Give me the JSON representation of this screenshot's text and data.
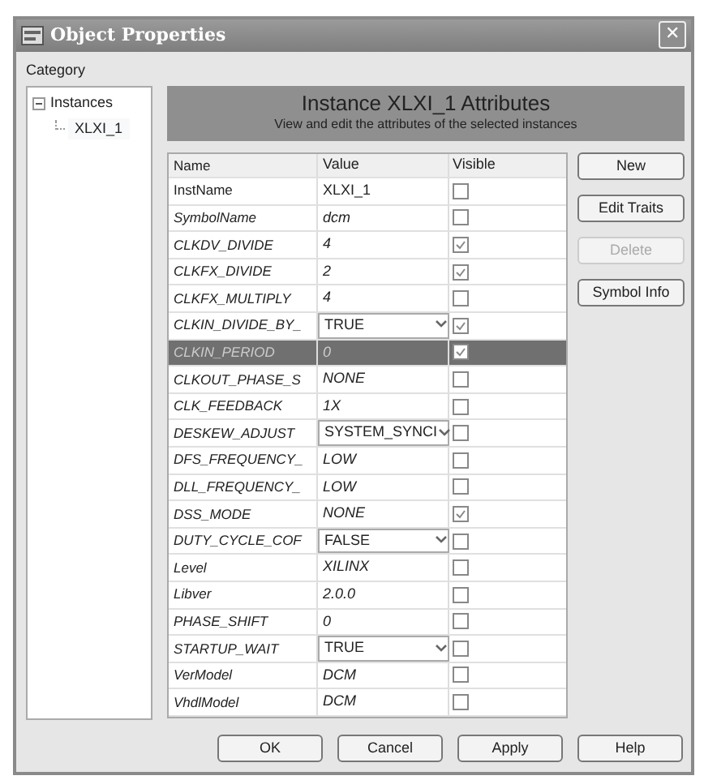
{
  "window": {
    "title": "Object Properties",
    "close": "✕"
  },
  "category": {
    "label": "Category",
    "tree": [
      {
        "label": "Instances",
        "expanded": true,
        "children": [
          {
            "label": "XLXI_1",
            "selected": true
          }
        ]
      }
    ]
  },
  "header": {
    "title": "Instance XLXI_1 Attributes",
    "subtitle": "View and edit the attributes of the selected instances"
  },
  "table": {
    "columns": [
      "Name",
      "Value",
      "Visible"
    ],
    "rows": [
      {
        "name": "InstName",
        "value": "XLXI_1",
        "kind": "fixed",
        "visible": false,
        "selected": false
      },
      {
        "name": "SymbolName",
        "value": "dcm",
        "kind": "text",
        "visible": false,
        "selected": false
      },
      {
        "name": "CLKDV_DIVIDE",
        "value": "4",
        "kind": "text",
        "visible": true,
        "selected": false
      },
      {
        "name": "CLKFX_DIVIDE",
        "value": "2",
        "kind": "text",
        "visible": true,
        "selected": false
      },
      {
        "name": "CLKFX_MULTIPLY",
        "value": "4",
        "kind": "text",
        "visible": false,
        "selected": false
      },
      {
        "name": "CLKIN_DIVIDE_BY_",
        "value": "TRUE",
        "kind": "choice",
        "visible": true,
        "selected": false
      },
      {
        "name": "CLKIN_PERIOD",
        "value": "0",
        "kind": "text",
        "visible": true,
        "selected": true
      },
      {
        "name": "CLKOUT_PHASE_S",
        "value": "NONE",
        "kind": "text",
        "visible": false,
        "selected": false
      },
      {
        "name": "CLK_FEEDBACK",
        "value": "1X",
        "kind": "text",
        "visible": false,
        "selected": false
      },
      {
        "name": "DESKEW_ADJUST",
        "value": "SYSTEM_SYNCI",
        "kind": "choice",
        "visible": false,
        "selected": false
      },
      {
        "name": "DFS_FREQUENCY_",
        "value": "LOW",
        "kind": "text",
        "visible": false,
        "selected": false
      },
      {
        "name": "DLL_FREQUENCY_",
        "value": "LOW",
        "kind": "text",
        "visible": false,
        "selected": false
      },
      {
        "name": "DSS_MODE",
        "value": "NONE",
        "kind": "text",
        "visible": true,
        "selected": false
      },
      {
        "name": "DUTY_CYCLE_COF",
        "value": "FALSE",
        "kind": "choice",
        "visible": false,
        "selected": false
      },
      {
        "name": "Level",
        "value": "XILINX",
        "kind": "text",
        "visible": false,
        "selected": false
      },
      {
        "name": "Libver",
        "value": "2.0.0",
        "kind": "text",
        "visible": false,
        "selected": false
      },
      {
        "name": "PHASE_SHIFT",
        "value": "0",
        "kind": "text",
        "visible": false,
        "selected": false
      },
      {
        "name": "STARTUP_WAIT",
        "value": "TRUE",
        "kind": "choice",
        "visible": false,
        "selected": false
      },
      {
        "name": "VerModel",
        "value": "DCM",
        "kind": "text",
        "visible": false,
        "selected": false
      },
      {
        "name": "VhdlModel",
        "value": "DCM",
        "kind": "text",
        "visible": false,
        "selected": false
      }
    ]
  },
  "side_buttons": [
    {
      "label": "New",
      "disabled": false
    },
    {
      "label": "Edit Traits",
      "disabled": false
    },
    {
      "label": "Delete",
      "disabled": true
    },
    {
      "label": "Symbol Info",
      "disabled": false
    }
  ],
  "buttons": [
    "OK",
    "Cancel",
    "Apply",
    "Help"
  ]
}
